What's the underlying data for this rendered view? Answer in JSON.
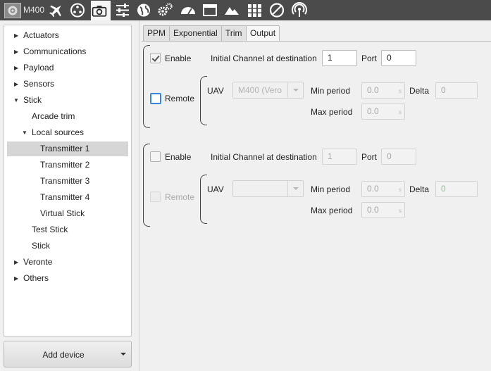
{
  "toolbar": {
    "title": "M400",
    "icons": [
      "gear-icon",
      "plane-icon",
      "joystick-icon",
      "camera-icon",
      "sliders-icon",
      "globe-icon",
      "cogs-icon",
      "dashboard-icon",
      "window-icon",
      "mountain-icon",
      "grid-icon",
      "block-icon",
      "antenna-icon"
    ],
    "active_icon": "camera-icon"
  },
  "sidebar": {
    "items": [
      {
        "label": "Actuators",
        "level": 0,
        "arrow": "collapsed"
      },
      {
        "label": "Communications",
        "level": 0,
        "arrow": "collapsed"
      },
      {
        "label": "Payload",
        "level": 0,
        "arrow": "collapsed"
      },
      {
        "label": "Sensors",
        "level": 0,
        "arrow": "collapsed"
      },
      {
        "label": "Stick",
        "level": 0,
        "arrow": "expanded"
      },
      {
        "label": "Arcade trim",
        "level": 1,
        "arrow": "none"
      },
      {
        "label": "Local sources",
        "level": 1,
        "arrow": "expanded"
      },
      {
        "label": "Transmitter 1",
        "level": 2,
        "arrow": "none",
        "selected": true
      },
      {
        "label": "Transmitter 2",
        "level": 2,
        "arrow": "none"
      },
      {
        "label": "Transmitter 3",
        "level": 2,
        "arrow": "none"
      },
      {
        "label": "Transmitter 4",
        "level": 2,
        "arrow": "none"
      },
      {
        "label": "Virtual Stick",
        "level": 2,
        "arrow": "none"
      },
      {
        "label": "Test Stick",
        "level": 1,
        "arrow": "none"
      },
      {
        "label": "Stick",
        "level": 1,
        "arrow": "none"
      },
      {
        "label": "Veronte",
        "level": 0,
        "arrow": "collapsed"
      },
      {
        "label": "Others",
        "level": 0,
        "arrow": "collapsed"
      }
    ],
    "add_device_label": "Add device"
  },
  "tabs": [
    {
      "label": "PPM",
      "active": false
    },
    {
      "label": "Exponential",
      "active": false
    },
    {
      "label": "Trim",
      "active": false
    },
    {
      "label": "Output",
      "active": true
    }
  ],
  "outputs": [
    {
      "enable_label": "Enable",
      "enable_checked": true,
      "channel_label": "Initial Channel at destination",
      "channel_value": "1",
      "port_label": "Port",
      "port_value": "0",
      "remote_label": "Remote",
      "remote_checked": false,
      "uav_label": "UAV",
      "uav_value": "M400 (Vero",
      "min_period_label": "Min period",
      "min_period_value": "0.0",
      "min_unit": "s",
      "max_period_label": "Max period",
      "max_period_value": "0.0",
      "max_unit": "s",
      "delta_label": "Delta",
      "delta_value": "0"
    },
    {
      "enable_label": "Enable",
      "enable_checked": false,
      "channel_label": "Initial Channel at destination",
      "channel_value": "1",
      "port_label": "Port",
      "port_value": "0",
      "remote_label": "Remote",
      "remote_checked": false,
      "uav_label": "UAV",
      "uav_value": "",
      "min_period_label": "Min period",
      "min_period_value": "0.0",
      "min_unit": "s",
      "max_period_label": "Max period",
      "max_period_value": "0.0",
      "max_unit": "s",
      "delta_label": "Delta",
      "delta_value": "0"
    }
  ]
}
